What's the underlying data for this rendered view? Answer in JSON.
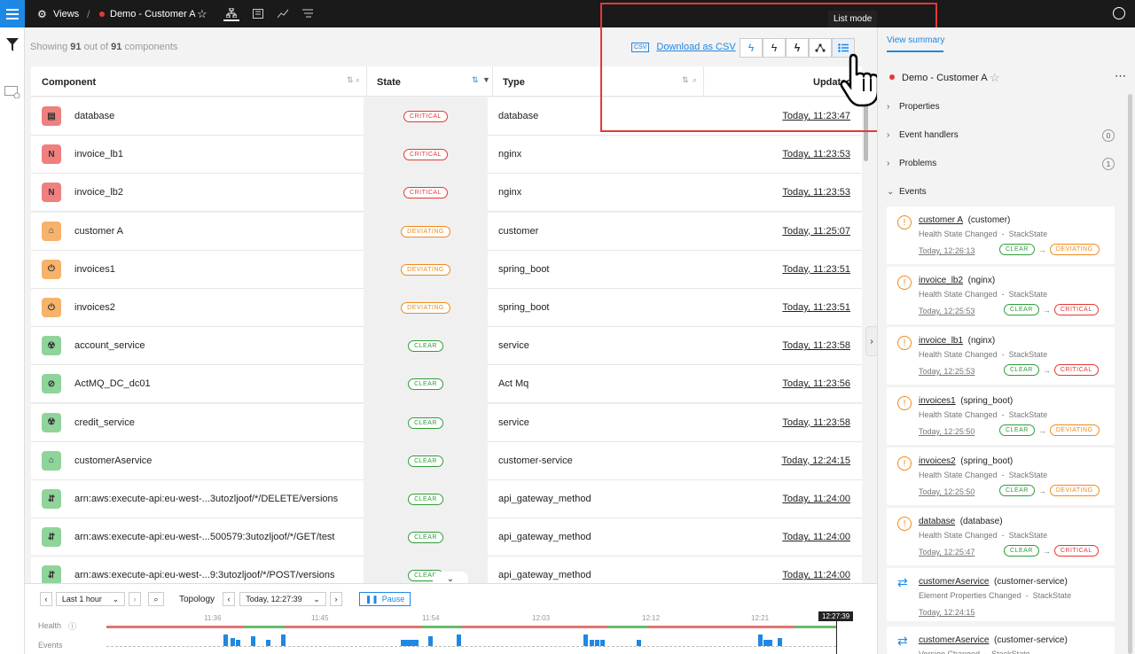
{
  "topbar": {
    "views_label": "Views",
    "view_name": "Demo - Customer A"
  },
  "toolbar": {
    "showing_prefix": "Showing",
    "showing_count": "91",
    "showing_mid": "out of",
    "showing_total": "91",
    "showing_suffix": "components",
    "download_label": "Download as CSV",
    "tooltip": "List mode"
  },
  "table": {
    "headers": {
      "component": "Component",
      "state": "State",
      "type": "Type",
      "updated": "Updated"
    },
    "rows": [
      {
        "name": "database",
        "state": "CRITICAL",
        "type": "database",
        "updated": "Today, 11:23:47",
        "icon": "database-icon",
        "color": "#f07f7f",
        "glyph": "▤"
      },
      {
        "name": "invoice_lb1",
        "state": "CRITICAL",
        "type": "nginx",
        "updated": "Today, 11:23:53",
        "icon": "nginx-icon",
        "color": "#f07f7f",
        "glyph": "N"
      },
      {
        "name": "invoice_lb2",
        "state": "CRITICAL",
        "type": "nginx",
        "updated": "Today, 11:23:53",
        "icon": "nginx-icon",
        "color": "#f07f7f",
        "glyph": "N"
      },
      {
        "name": "customer A",
        "state": "DEVIATING",
        "type": "customer",
        "updated": "Today, 11:25:07",
        "icon": "customer-icon",
        "color": "#f7b26b",
        "glyph": "⌂"
      },
      {
        "name": "invoices1",
        "state": "DEVIATING",
        "type": "spring_boot",
        "updated": "Today, 11:23:51",
        "icon": "spring-boot-icon",
        "color": "#f7b26b",
        "glyph": "⏻"
      },
      {
        "name": "invoices2",
        "state": "DEVIATING",
        "type": "spring_boot",
        "updated": "Today, 11:23:51",
        "icon": "spring-boot-icon",
        "color": "#f7b26b",
        "glyph": "⏻"
      },
      {
        "name": "account_service",
        "state": "CLEAR",
        "type": "service",
        "updated": "Today, 11:23:58",
        "icon": "service-icon",
        "color": "#8fd49a",
        "glyph": "☢"
      },
      {
        "name": "ActMQ_DC_dc01",
        "state": "CLEAR",
        "type": "Act Mq",
        "updated": "Today, 11:23:56",
        "icon": "activemq-icon",
        "color": "#8fd49a",
        "glyph": "⊘"
      },
      {
        "name": "credit_service",
        "state": "CLEAR",
        "type": "service",
        "updated": "Today, 11:23:58",
        "icon": "service-icon",
        "color": "#8fd49a",
        "glyph": "☢"
      },
      {
        "name": "customerAservice",
        "state": "CLEAR",
        "type": "customer-service",
        "updated": "Today, 12:24:15",
        "icon": "customer-service-icon",
        "color": "#8fd49a",
        "glyph": "⌂"
      },
      {
        "name": "arn:aws:execute-api:eu-west-...3utozljoof/*/DELETE/versions",
        "state": "CLEAR",
        "type": "api_gateway_method",
        "updated": "Today, 11:24:00",
        "icon": "api-gateway-icon",
        "color": "#8fd49a",
        "glyph": "⇵"
      },
      {
        "name": "arn:aws:execute-api:eu-west-...500579:3utozljoof/*/GET/test",
        "state": "CLEAR",
        "type": "api_gateway_method",
        "updated": "Today, 11:24:00",
        "icon": "api-gateway-icon",
        "color": "#8fd49a",
        "glyph": "⇵"
      },
      {
        "name": "arn:aws:execute-api:eu-west-...9:3utozljoof/*/POST/versions",
        "state": "CLEAR",
        "type": "api_gateway_method",
        "updated": "Today, 11:24:00",
        "icon": "api-gateway-icon",
        "color": "#8fd49a",
        "glyph": "⇵"
      }
    ]
  },
  "timeline": {
    "range_label": "Last 1 hour",
    "topology_label": "Topology",
    "topology_time": "Today, 12:27:39",
    "pause_label": "Pause",
    "health_label": "Health",
    "events_label": "Events",
    "ticks": [
      "11:36",
      "11:45",
      "11:54",
      "12:03",
      "12:12",
      "12:21"
    ],
    "current_time": "12:27:39"
  },
  "panel": {
    "tab_summary": "View summary",
    "view_name": "Demo - Customer A",
    "sections": {
      "properties": "Properties",
      "event_handlers": "Event handlers",
      "problems": "Problems",
      "events": "Events"
    },
    "counts": {
      "event_handlers": "0",
      "problems": "1"
    },
    "events": [
      {
        "name": "customer A",
        "type": "(customer)",
        "desc": "Health State Changed",
        "sep": "-",
        "source": "StackState",
        "time": "Today, 12:26:13",
        "from": "CLEAR",
        "to": "DEVIATING"
      },
      {
        "name": "invoice_lb2",
        "type": "(nginx)",
        "desc": "Health State Changed",
        "sep": "-",
        "source": "StackState",
        "time": "Today, 12:25:53",
        "from": "CLEAR",
        "to": "CRITICAL"
      },
      {
        "name": "invoice_lb1",
        "type": "(nginx)",
        "desc": "Health State Changed",
        "sep": "-",
        "source": "StackState",
        "time": "Today, 12:25:53",
        "from": "CLEAR",
        "to": "CRITICAL"
      },
      {
        "name": "invoices1",
        "type": "(spring_boot)",
        "desc": "Health State Changed",
        "sep": "-",
        "source": "StackState",
        "time": "Today, 12:25:50",
        "from": "CLEAR",
        "to": "DEVIATING"
      },
      {
        "name": "invoices2",
        "type": "(spring_boot)",
        "desc": "Health State Changed",
        "sep": "-",
        "source": "StackState",
        "time": "Today, 12:25:50",
        "from": "CLEAR",
        "to": "DEVIATING"
      },
      {
        "name": "database",
        "type": "(database)",
        "desc": "Health State Changed",
        "sep": "-",
        "source": "StackState",
        "time": "Today, 12:25:47",
        "from": "CLEAR",
        "to": "CRITICAL"
      },
      {
        "name": "customerAservice",
        "type": "(customer-service)",
        "desc": "Element Properties Changed",
        "sep": "-",
        "source": "StackState",
        "time": "Today, 12:24:15"
      },
      {
        "name": "customerAservice",
        "type": "(customer-service)",
        "desc": "Version Changed",
        "sep": "-",
        "source": "StackState"
      }
    ]
  },
  "colors": {
    "accent": "#1e88e5",
    "critical": "#e53935",
    "deviating": "#ef8a1a",
    "clear": "#2e9e3a",
    "highlight": "#e53935"
  }
}
